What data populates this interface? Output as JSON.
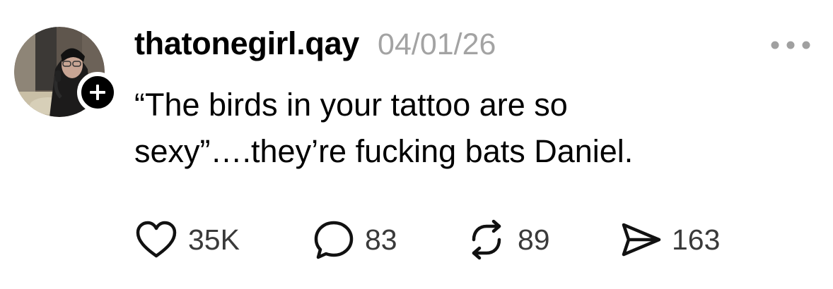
{
  "post": {
    "username": "thatonegirl.qay",
    "timestamp": "04/01/26",
    "text_lines": [
      "“The birds in your tattoo are so",
      "sexy”….they’re fucking bats Daniel."
    ],
    "more_icon": "ellipsis-icon",
    "follow_icon": "plus-icon"
  },
  "actions": {
    "like": {
      "icon": "heart-icon",
      "count": "35K"
    },
    "comment": {
      "icon": "speech-bubble-icon",
      "count": "83"
    },
    "repost": {
      "icon": "repost-icon",
      "count": "89"
    },
    "share": {
      "icon": "send-icon",
      "count": "163"
    }
  }
}
